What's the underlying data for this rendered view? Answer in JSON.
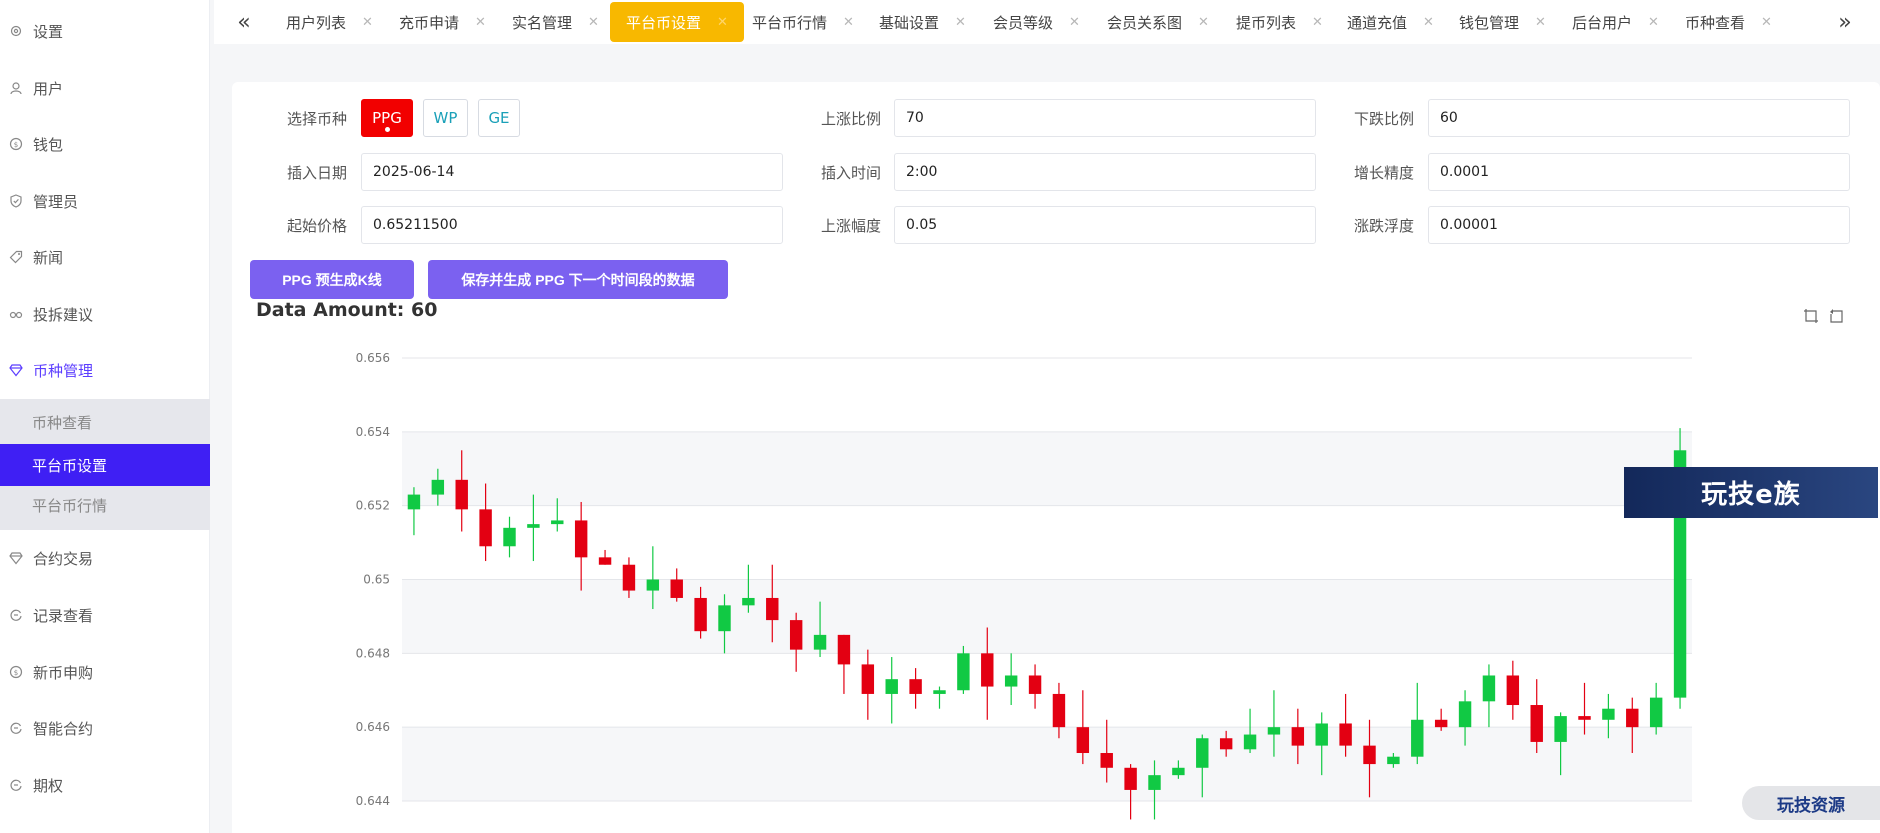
{
  "sidebar": {
    "items": [
      {
        "label": "设置",
        "icon": "gear-icon"
      },
      {
        "label": "用户",
        "icon": "user-icon"
      },
      {
        "label": "钱包",
        "icon": "coin-icon"
      },
      {
        "label": "管理员",
        "icon": "shield-icon"
      },
      {
        "label": "新闻",
        "icon": "tag-icon"
      },
      {
        "label": "投拆建议",
        "icon": "link-icon"
      },
      {
        "label": "币种管理",
        "icon": "diamond-icon"
      },
      {
        "label": "合约交易",
        "icon": "diamond-icon"
      },
      {
        "label": "记录查看",
        "icon": "refresh-icon"
      },
      {
        "label": "新币申购",
        "icon": "coin-icon"
      },
      {
        "label": "智能合约",
        "icon": "refresh-icon"
      },
      {
        "label": "期权",
        "icon": "refresh-icon"
      }
    ],
    "submenu": [
      {
        "label": "币种查看"
      },
      {
        "label": "平台币设置"
      },
      {
        "label": "平台币行情"
      }
    ]
  },
  "tabs": [
    {
      "label": "用户列表"
    },
    {
      "label": "充币申请"
    },
    {
      "label": "实名管理"
    },
    {
      "label": "平台币设置"
    },
    {
      "label": "平台币行情"
    },
    {
      "label": "基础设置"
    },
    {
      "label": "会员等级"
    },
    {
      "label": "会员关系图"
    },
    {
      "label": "提币列表"
    },
    {
      "label": "通道充值"
    },
    {
      "label": "钱包管理"
    },
    {
      "label": "后台用户"
    },
    {
      "label": "币种查看"
    }
  ],
  "form": {
    "coin_label": "选择币种",
    "coins": [
      "PPG",
      "WP",
      "GE"
    ],
    "rise_ratio_label": "上涨比例",
    "rise_ratio": "70",
    "fall_ratio_label": "下跌比例",
    "fall_ratio": "60",
    "insert_date_label": "插入日期",
    "insert_date": "2025-06-14",
    "insert_time_label": "插入时间",
    "insert_time": "2:00",
    "precision_label": "增长精度",
    "precision": "0.0001",
    "start_price_label": "起始价格",
    "start_price": "0.65211500",
    "rise_amp_label": "上涨幅度",
    "rise_amp": "0.05",
    "fluct_label": "涨跌浮度",
    "fluct": "0.00001"
  },
  "buttons": {
    "pregenerate": "PPG 预生成K线",
    "save_generate": "保存并生成 PPG 下一个时间段的数据"
  },
  "data_amount": "Data Amount: 60",
  "watermark": "玩技e族",
  "watermark2": "玩技资源",
  "colors": {
    "up": "#11c944",
    "down": "#e30012",
    "accent": "#f8b800",
    "primary": "#3f1ff4"
  },
  "chart_data": {
    "type": "candlestick",
    "ylim": [
      0.644,
      0.656
    ],
    "yticks": [
      "0.656",
      "0.654",
      "0.652",
      "0.65",
      "0.648",
      "0.646",
      "0.644"
    ],
    "candles": [
      [
        0.6519,
        0.6523,
        0.6525,
        0.6512
      ],
      [
        0.6523,
        0.6527,
        0.653,
        0.652
      ],
      [
        0.6527,
        0.6519,
        0.6535,
        0.6513
      ],
      [
        0.6519,
        0.6509,
        0.6526,
        0.6505
      ],
      [
        0.6509,
        0.6514,
        0.6517,
        0.6506
      ],
      [
        0.6514,
        0.6515,
        0.6523,
        0.6505
      ],
      [
        0.6515,
        0.6516,
        0.6522,
        0.6513
      ],
      [
        0.6516,
        0.6506,
        0.6521,
        0.6497
      ],
      [
        0.6506,
        0.6504,
        0.6508,
        0.6504
      ],
      [
        0.6504,
        0.6497,
        0.6506,
        0.6495
      ],
      [
        0.6497,
        0.65,
        0.6509,
        0.6492
      ],
      [
        0.65,
        0.6495,
        0.6503,
        0.6494
      ],
      [
        0.6495,
        0.6486,
        0.6498,
        0.6484
      ],
      [
        0.6486,
        0.6493,
        0.6496,
        0.648
      ],
      [
        0.6493,
        0.6495,
        0.6504,
        0.6491
      ],
      [
        0.6495,
        0.6489,
        0.6504,
        0.6483
      ],
      [
        0.6489,
        0.6481,
        0.6491,
        0.6475
      ],
      [
        0.6481,
        0.6485,
        0.6494,
        0.6479
      ],
      [
        0.6485,
        0.6477,
        0.6485,
        0.6469
      ],
      [
        0.6477,
        0.6469,
        0.6481,
        0.6462
      ],
      [
        0.6469,
        0.6473,
        0.6479,
        0.6461
      ],
      [
        0.6473,
        0.6469,
        0.6476,
        0.6465
      ],
      [
        0.6469,
        0.647,
        0.6471,
        0.6465
      ],
      [
        0.647,
        0.648,
        0.6482,
        0.6469
      ],
      [
        0.648,
        0.6471,
        0.6487,
        0.6462
      ],
      [
        0.6471,
        0.6474,
        0.648,
        0.6466
      ],
      [
        0.6474,
        0.6469,
        0.6477,
        0.6465
      ],
      [
        0.6469,
        0.646,
        0.6472,
        0.6457
      ],
      [
        0.646,
        0.6453,
        0.647,
        0.645
      ],
      [
        0.6453,
        0.6449,
        0.6462,
        0.6445
      ],
      [
        0.6449,
        0.6443,
        0.645,
        0.6435
      ],
      [
        0.6443,
        0.6447,
        0.6451,
        0.6435
      ],
      [
        0.6447,
        0.6449,
        0.6451,
        0.6446
      ],
      [
        0.6449,
        0.6457,
        0.6458,
        0.6441
      ],
      [
        0.6457,
        0.6454,
        0.6459,
        0.6452
      ],
      [
        0.6454,
        0.6458,
        0.6465,
        0.6453
      ],
      [
        0.6458,
        0.646,
        0.647,
        0.6452
      ],
      [
        0.646,
        0.6455,
        0.6465,
        0.645
      ],
      [
        0.6455,
        0.6461,
        0.6464,
        0.6447
      ],
      [
        0.6461,
        0.6455,
        0.6469,
        0.6452
      ],
      [
        0.6455,
        0.645,
        0.6462,
        0.6441
      ],
      [
        0.645,
        0.6452,
        0.6453,
        0.6449
      ],
      [
        0.6452,
        0.6462,
        0.6472,
        0.645
      ],
      [
        0.6462,
        0.646,
        0.6465,
        0.6459
      ],
      [
        0.646,
        0.6467,
        0.647,
        0.6455
      ],
      [
        0.6467,
        0.6474,
        0.6477,
        0.646
      ],
      [
        0.6474,
        0.6466,
        0.6478,
        0.6462
      ],
      [
        0.6466,
        0.6456,
        0.6473,
        0.6453
      ],
      [
        0.6456,
        0.6463,
        0.6464,
        0.6447
      ],
      [
        0.6463,
        0.6462,
        0.6472,
        0.6458
      ],
      [
        0.6462,
        0.6465,
        0.6469,
        0.6457
      ],
      [
        0.6465,
        0.646,
        0.6468,
        0.6453
      ],
      [
        0.646,
        0.6468,
        0.6472,
        0.6458
      ],
      [
        0.6468,
        0.6535,
        0.6541,
        0.6465
      ]
    ]
  }
}
